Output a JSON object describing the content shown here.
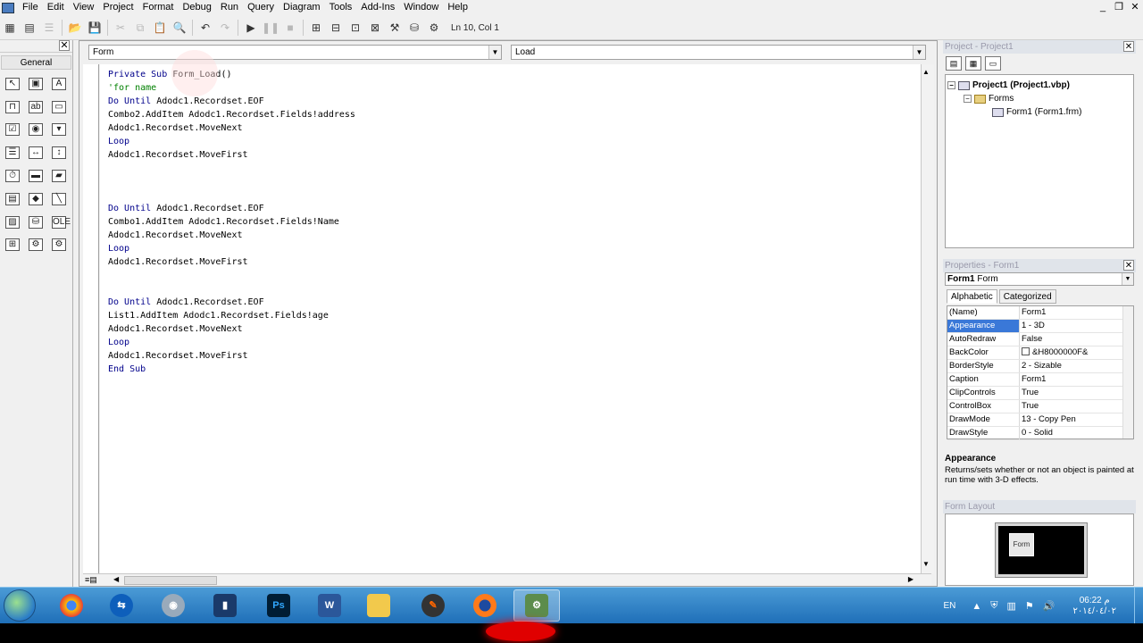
{
  "menu": [
    "File",
    "Edit",
    "View",
    "Project",
    "Format",
    "Debug",
    "Run",
    "Query",
    "Diagram",
    "Tools",
    "Add-Ins",
    "Window",
    "Help"
  ],
  "window_controls": {
    "minimize": "_",
    "restore": "❐",
    "close": "✕"
  },
  "toolbar": {
    "status": "Ln 10, Col 1"
  },
  "toolbox": {
    "tab_label": "General",
    "close": "✕"
  },
  "code_window": {
    "object_combo": "Form",
    "procedure_combo": "Load",
    "lines": [
      "Private Sub Form_Load()",
      "'for name",
      "Do Until Adodc1.Recordset.EOF",
      "Combo2.AddItem Adodc1.Recordset.Fields!address",
      "Adodc1.Recordset.MoveNext",
      "Loop",
      "Adodc1.Recordset.MoveFirst",
      "",
      "",
      "",
      "Do Until Adodc1.Recordset.EOF",
      "Combo1.AddItem Adodc1.Recordset.Fields!Name",
      "Adodc1.Recordset.MoveNext",
      "Loop",
      "Adodc1.Recordset.MoveFirst",
      "",
      "",
      "Do Until Adodc1.Recordset.EOF",
      "List1.AddItem Adodc1.Recordset.Fields!age",
      "Adodc1.Recordset.MoveNext",
      "Loop",
      "Adodc1.Recordset.MoveFirst",
      "End Sub"
    ]
  },
  "project": {
    "title": "Project - Project1",
    "root": "Project1 (Project1.vbp)",
    "folder": "Forms",
    "form": "Form1 (Form1.frm)"
  },
  "properties": {
    "title": "Properties - Form1",
    "object_name": "Form1",
    "object_type": "Form",
    "tabs": [
      "Alphabetic",
      "Categorized"
    ],
    "rows": [
      {
        "name": "(Name)",
        "value": "Form1"
      },
      {
        "name": "Appearance",
        "value": "1 - 3D"
      },
      {
        "name": "AutoRedraw",
        "value": "False"
      },
      {
        "name": "BackColor",
        "value": "&H8000000F&"
      },
      {
        "name": "BorderStyle",
        "value": "2 - Sizable"
      },
      {
        "name": "Caption",
        "value": "Form1"
      },
      {
        "name": "ClipControls",
        "value": "True"
      },
      {
        "name": "ControlBox",
        "value": "True"
      },
      {
        "name": "DrawMode",
        "value": "13 - Copy Pen"
      },
      {
        "name": "DrawStyle",
        "value": "0 - Solid"
      }
    ],
    "desc_title": "Appearance",
    "desc_text": "Returns/sets whether or not an object is painted at run time with 3-D effects."
  },
  "form_layout": {
    "title": "Form Layout",
    "mini_form": "Form"
  },
  "taskbar": {
    "apps": [
      "chrome",
      "teamviewer",
      "media-center",
      "vb-book",
      "photoshop",
      "word",
      "explorer",
      "paint",
      "firefox",
      "vb6"
    ],
    "app_labels": {
      "photoshop": "Ps",
      "word": "W"
    },
    "lang": "EN",
    "time": "06:22 م",
    "date": "٢٠١٤/٠٤/٠٢"
  },
  "colors": {
    "keyword": "#00008b",
    "comment": "#008000",
    "selection": "#3a78d8",
    "taskbar": "#2a7cc8"
  }
}
